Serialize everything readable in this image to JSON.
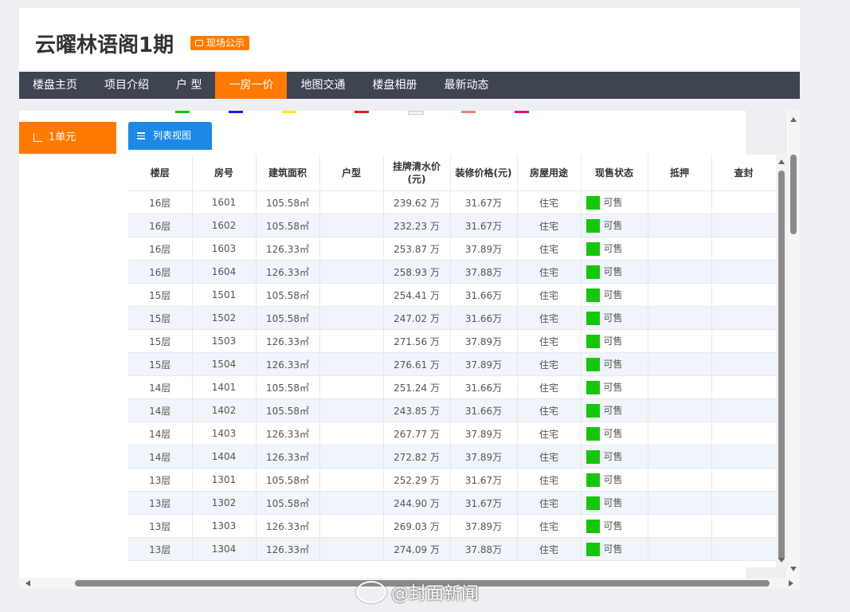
{
  "header": {
    "title": "云曜林语阁1期",
    "badge": "现场公示"
  },
  "nav": {
    "items": [
      {
        "label": "楼盘主页"
      },
      {
        "label": "项目介绍"
      },
      {
        "label": "户 型"
      },
      {
        "label": "一房一价",
        "active": true
      },
      {
        "label": "地图交通"
      },
      {
        "label": "楼盘相册"
      },
      {
        "label": "最新动态"
      }
    ]
  },
  "sidebar": {
    "unit": "1单元"
  },
  "legend_colors": [
    "#16c60c",
    "#1d1dd6",
    "#f5f000",
    "#e0201e",
    "#f2f2f2",
    "#f28080",
    "#e6127c"
  ],
  "view_button": "列表视图",
  "table": {
    "columns": [
      "楼层",
      "房号",
      "建筑面积",
      "户型",
      "挂牌清水价\n(元)",
      "装修价格(元)",
      "房屋用途",
      "现售状态",
      "抵押",
      "查封"
    ],
    "status_color": "#16c60c",
    "rows": [
      [
        "16层",
        "1601",
        "105.58㎡",
        "",
        "239.62 万",
        "31.67万",
        "住宅",
        "可售",
        "",
        ""
      ],
      [
        "16层",
        "1602",
        "105.58㎡",
        "",
        "232.23 万",
        "31.67万",
        "住宅",
        "可售",
        "",
        ""
      ],
      [
        "16层",
        "1603",
        "126.33㎡",
        "",
        "253.87 万",
        "37.89万",
        "住宅",
        "可售",
        "",
        ""
      ],
      [
        "16层",
        "1604",
        "126.33㎡",
        "",
        "258.93 万",
        "37.88万",
        "住宅",
        "可售",
        "",
        ""
      ],
      [
        "15层",
        "1501",
        "105.58㎡",
        "",
        "254.41 万",
        "31.66万",
        "住宅",
        "可售",
        "",
        ""
      ],
      [
        "15层",
        "1502",
        "105.58㎡",
        "",
        "247.02 万",
        "31.66万",
        "住宅",
        "可售",
        "",
        ""
      ],
      [
        "15层",
        "1503",
        "126.33㎡",
        "",
        "271.56 万",
        "37.89万",
        "住宅",
        "可售",
        "",
        ""
      ],
      [
        "15层",
        "1504",
        "126.33㎡",
        "",
        "276.61 万",
        "37.89万",
        "住宅",
        "可售",
        "",
        ""
      ],
      [
        "14层",
        "1401",
        "105.58㎡",
        "",
        "251.24 万",
        "31.66万",
        "住宅",
        "可售",
        "",
        ""
      ],
      [
        "14层",
        "1402",
        "105.58㎡",
        "",
        "243.85 万",
        "31.66万",
        "住宅",
        "可售",
        "",
        ""
      ],
      [
        "14层",
        "1403",
        "126.33㎡",
        "",
        "267.77 万",
        "37.89万",
        "住宅",
        "可售",
        "",
        ""
      ],
      [
        "14层",
        "1404",
        "126.33㎡",
        "",
        "272.82 万",
        "37.89万",
        "住宅",
        "可售",
        "",
        ""
      ],
      [
        "13层",
        "1301",
        "105.58㎡",
        "",
        "252.29 万",
        "31.67万",
        "住宅",
        "可售",
        "",
        ""
      ],
      [
        "13层",
        "1302",
        "105.58㎡",
        "",
        "244.90 万",
        "31.67万",
        "住宅",
        "可售",
        "",
        ""
      ],
      [
        "13层",
        "1303",
        "126.33㎡",
        "",
        "269.03 万",
        "37.89万",
        "住宅",
        "可售",
        "",
        ""
      ],
      [
        "13层",
        "1304",
        "126.33㎡",
        "",
        "274.09 万",
        "37.88万",
        "住宅",
        "可售",
        "",
        ""
      ]
    ]
  },
  "watermark": "@封面新闻"
}
